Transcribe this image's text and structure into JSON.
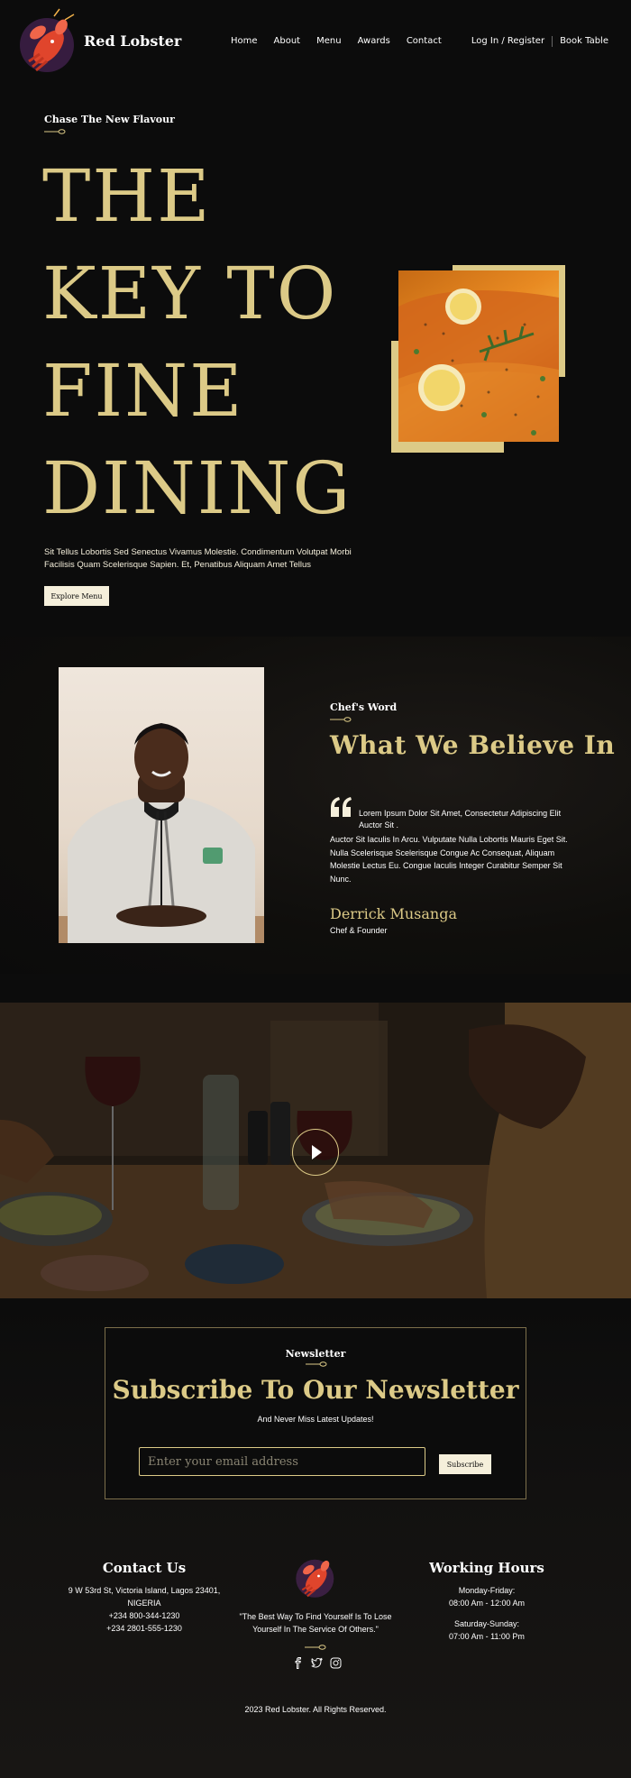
{
  "brand": {
    "name": "Red Lobster"
  },
  "nav": {
    "links": [
      "Home",
      "About",
      "Menu",
      "Awards",
      "Contact"
    ],
    "login": "Log In / Register",
    "book": "Book Table"
  },
  "hero": {
    "subtitle": "Chase The New Flavour",
    "title_lines": [
      "THE",
      "KEY TO",
      "FINE",
      "DINING"
    ],
    "description": "Sit Tellus Lobortis Sed Senectus Vivamus Molestie. Condimentum Volutpat Morbi Facilisis Quam Scelerisque Sapien. Et, Penatibus Aliquam Amet Tellus",
    "button": "Explore Menu"
  },
  "chef": {
    "label": "Chef's Word",
    "title": "What We Believe In",
    "quote_first": "Lorem Ipsum Dolor Sit Amet, Consectetur Adipiscing Elit Auctor Sit .",
    "quote_rest": "Auctor Sit Iaculis In Arcu. Vulputate Nulla Lobortis Mauris Eget Sit. Nulla Scelerisque Scelerisque Congue Ac Consequat, Aliquam Molestie Lectus Eu. Congue Iaculis Integer Curabitur Semper Sit Nunc.",
    "name": "Derrick Musanga",
    "role": "Chef & Founder"
  },
  "newsletter": {
    "label": "Newsletter",
    "title": "Subscribe To Our Newsletter",
    "subtitle": "And Never Miss Latest Updates!",
    "placeholder": "Enter your email address",
    "button": "Subscribe"
  },
  "footer": {
    "contact": {
      "title": "Contact Us",
      "address": "9 W 53rd St, Victoria Island, Lagos 23401, NIGERIA",
      "phone1": "+234 800-344-1230",
      "phone2": "+234 2801-555-1230"
    },
    "tagline": "\"The Best Way To Find Yourself Is To Lose Yourself In The Service Of Others.\"",
    "hours": {
      "title": "Working Hours",
      "weekday_label": "Monday-Friday:",
      "weekday_time": "08:00 Am - 12:00 Am",
      "weekend_label": "Saturday-Sunday:",
      "weekend_time": "07:00 Am - 11:00 Pm"
    },
    "copyright": "2023 Red Lobster. All Rights Reserved."
  },
  "colors": {
    "background": "#0c0c0c",
    "gold": "#dcca87",
    "cream": "#f5efdb",
    "lobster_red": "#e0452c"
  },
  "icons": [
    "lobster-logo-icon",
    "spoon-divider-icon",
    "quote-icon",
    "play-icon",
    "facebook-icon",
    "twitter-icon",
    "instagram-icon"
  ]
}
